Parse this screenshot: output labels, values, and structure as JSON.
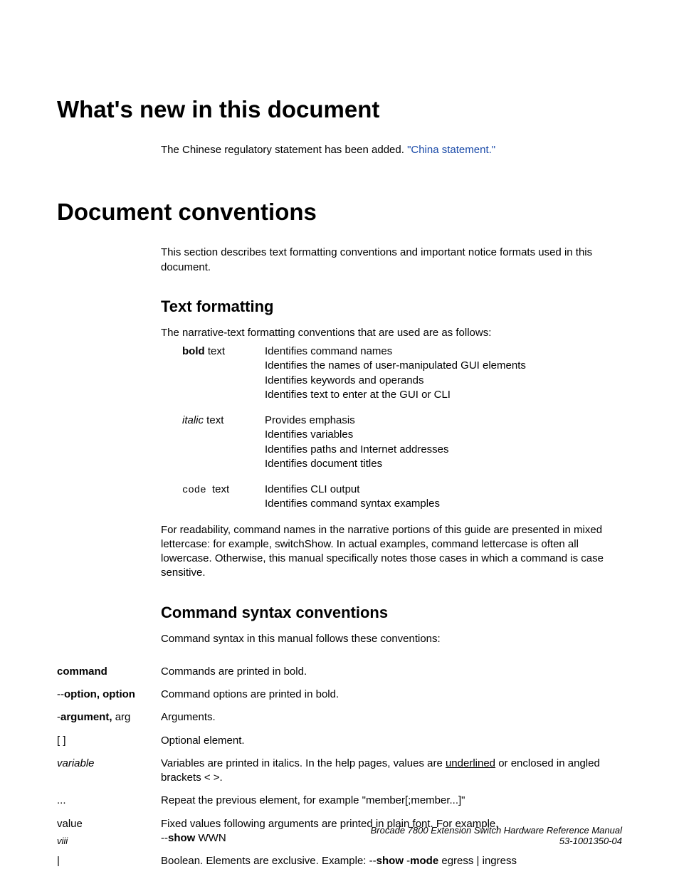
{
  "headings": {
    "whats_new": "What's new in this document",
    "doc_conventions": "Document conventions",
    "text_formatting": "Text formatting",
    "cmd_syntax": "Command syntax conventions"
  },
  "whats_new_para_lead": "The Chinese regulatory statement has been added. ",
  "whats_new_link": "\"China statement.\"",
  "doc_conventions_para": "This section describes text formatting conventions and important notice formats used in this document.",
  "tf_intro": "The narrative-text formatting conventions that are used are as follows:",
  "tf_rows": {
    "bold": {
      "label_bold": "bold",
      "label_rest": " text",
      "lines": [
        "Identifies command names",
        "Identifies the names of user-manipulated GUI elements",
        "Identifies keywords and operands",
        "Identifies text to enter at the GUI or CLI"
      ]
    },
    "italic": {
      "label_ital": "italic",
      "label_rest": " text",
      "lines": [
        "Provides emphasis",
        "Identifies variables",
        "Identifies paths and Internet addresses",
        "Identifies document titles"
      ]
    },
    "code": {
      "label_code": "code ",
      "label_rest": "text",
      "lines": [
        "Identifies CLI output",
        "Identifies command syntax examples"
      ]
    }
  },
  "tf_after_para": "For readability, command names in the narrative portions of this guide are presented in mixed lettercase: for example, switchShow. In actual examples, command lettercase is often all lowercase. Otherwise, this manual specifically notes those cases in which a command is case sensitive.",
  "syn_intro": "Command syntax in this manual follows these conventions:",
  "syn_rows": {
    "command": {
      "label_bold": "command",
      "desc": "Commands are printed in bold."
    },
    "option": {
      "label_prefix": "--",
      "label_bold": "option, option",
      "desc": "Command options are printed in bold."
    },
    "argument": {
      "label_prefix": "-",
      "label_bold": "argument, ",
      "label_tail": "arg",
      "desc": "Arguments."
    },
    "brackets": {
      "label": "[ ]",
      "desc": "Optional element."
    },
    "variable": {
      "label_ital": "variable",
      "desc_pre": "Variables are printed in italics. In the help pages, values are ",
      "desc_underlined": "underlined",
      "desc_post": " or enclosed in angled brackets < >."
    },
    "ellipsis": {
      "label": "...",
      "desc": "Repeat the previous element, for example \"member[;member...]\""
    },
    "value": {
      "label": "value",
      "desc_pre": "Fixed values following arguments are printed in plain font. For example, ",
      "show_prefix": "--",
      "show_bold": "show",
      "show_tail": " WWN"
    },
    "pipe": {
      "label": "|",
      "desc_pre": "Boolean. Elements are exclusive. Example: ",
      "p1": "--",
      "b1": "show ",
      "p2": "-",
      "b2": "mode",
      "tail": " egress | ingress"
    }
  },
  "footer": {
    "page": "viii",
    "title": "Brocade 7800 Extension Switch Hardware Reference Manual",
    "docnum": "53-1001350-04"
  }
}
